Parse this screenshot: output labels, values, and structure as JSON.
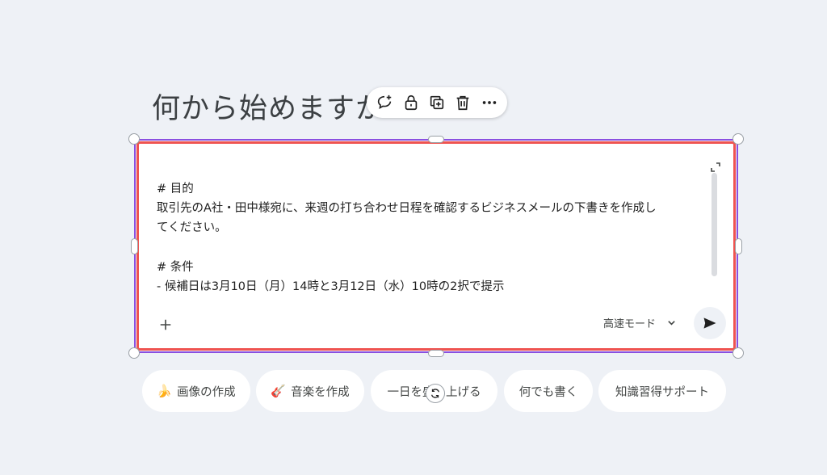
{
  "heading": "何から始めますか",
  "toolbar": {
    "icons": [
      "comment-add-icon",
      "lock-icon",
      "duplicate-icon",
      "delete-icon",
      "more-icon"
    ]
  },
  "prompt": {
    "lines": [
      "# 目的",
      "取引先のA社・田中様宛に、来週の打ち合わせ日程を確認するビジネスメールの下書きを作成し",
      "てください。",
      "",
      "# 条件",
      "- 候補日は3月10日（月）14時と3月12日（水）10時の2択で提示"
    ],
    "mode_label": "高速モード"
  },
  "chips": [
    {
      "emoji": "🍌",
      "label": "画像の作成"
    },
    {
      "emoji": "🎸",
      "label": "音楽を作成"
    },
    {
      "emoji": "",
      "label": "一日を盛り上げる"
    },
    {
      "emoji": "",
      "label": "何でも書く"
    },
    {
      "emoji": "",
      "label": "知識習得サポート"
    }
  ],
  "colors": {
    "background": "#eef1f6",
    "selection_outline": "#8a4fe0",
    "highlight_border": "#ef5350"
  }
}
